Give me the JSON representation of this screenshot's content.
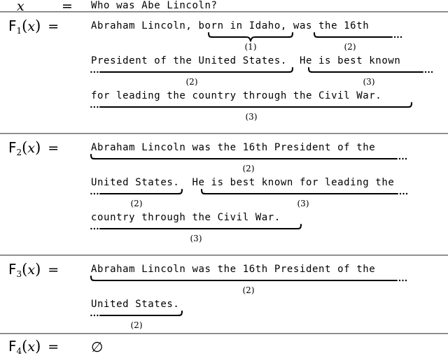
{
  "figure": {
    "type": "function-output-table",
    "question_row": {
      "lhs_var": "x",
      "equals": "=",
      "value": "Who was Abe Lincoln?"
    },
    "rows": [
      {
        "id": "F1",
        "fn_letter": "F",
        "fn_subscript": "1",
        "fn_arg": "x",
        "equals": "=",
        "lines": [
          "Abraham Lincoln, born in Idaho, was the 16th",
          "President of the United States.  He is best known",
          "for leading the country through the Civil War."
        ],
        "segments": [
          {
            "index": "(1)",
            "text": "born in Idaho,"
          },
          {
            "index": "(2)",
            "text": "was the 16th President of the United States."
          },
          {
            "index": "(3)",
            "text": "He is best known for leading the country through the Civil War."
          }
        ]
      },
      {
        "id": "F2",
        "fn_letter": "F",
        "fn_subscript": "2",
        "fn_arg": "x",
        "equals": "=",
        "lines": [
          "Abraham Lincoln was the 16th President of the",
          "United States.  He is best known for leading the",
          "country through the Civil War."
        ],
        "segments": [
          {
            "index": "(2)",
            "text": "Abraham Lincoln was the 16th President of the United States."
          },
          {
            "index": "(3)",
            "text": "He is best known for leading the country through the Civil War."
          }
        ]
      },
      {
        "id": "F3",
        "fn_letter": "F",
        "fn_subscript": "3",
        "fn_arg": "x",
        "equals": "=",
        "lines": [
          "Abraham Lincoln was the 16th President of the",
          "United States."
        ],
        "segments": [
          {
            "index": "(2)",
            "text": "Abraham Lincoln was the 16th President of the United States."
          }
        ]
      },
      {
        "id": "F4",
        "fn_letter": "F",
        "fn_subscript": "4",
        "fn_arg": "x",
        "equals": "=",
        "lines": [],
        "empty_symbol": "∅",
        "segments": []
      }
    ],
    "brace_labels": {
      "one": "(1)",
      "two_a": "(2)",
      "two_b": "(2)",
      "two_c": "(2)",
      "two_d": "(2)",
      "two_e": "(2)",
      "two_f": "(2)",
      "three_a": "(3)",
      "three_b": "(3)",
      "three_c": "(3)",
      "three_d": "(3)"
    },
    "colors": {
      "text": "#000000",
      "rule": "#777777",
      "background": "#ffffff"
    }
  }
}
